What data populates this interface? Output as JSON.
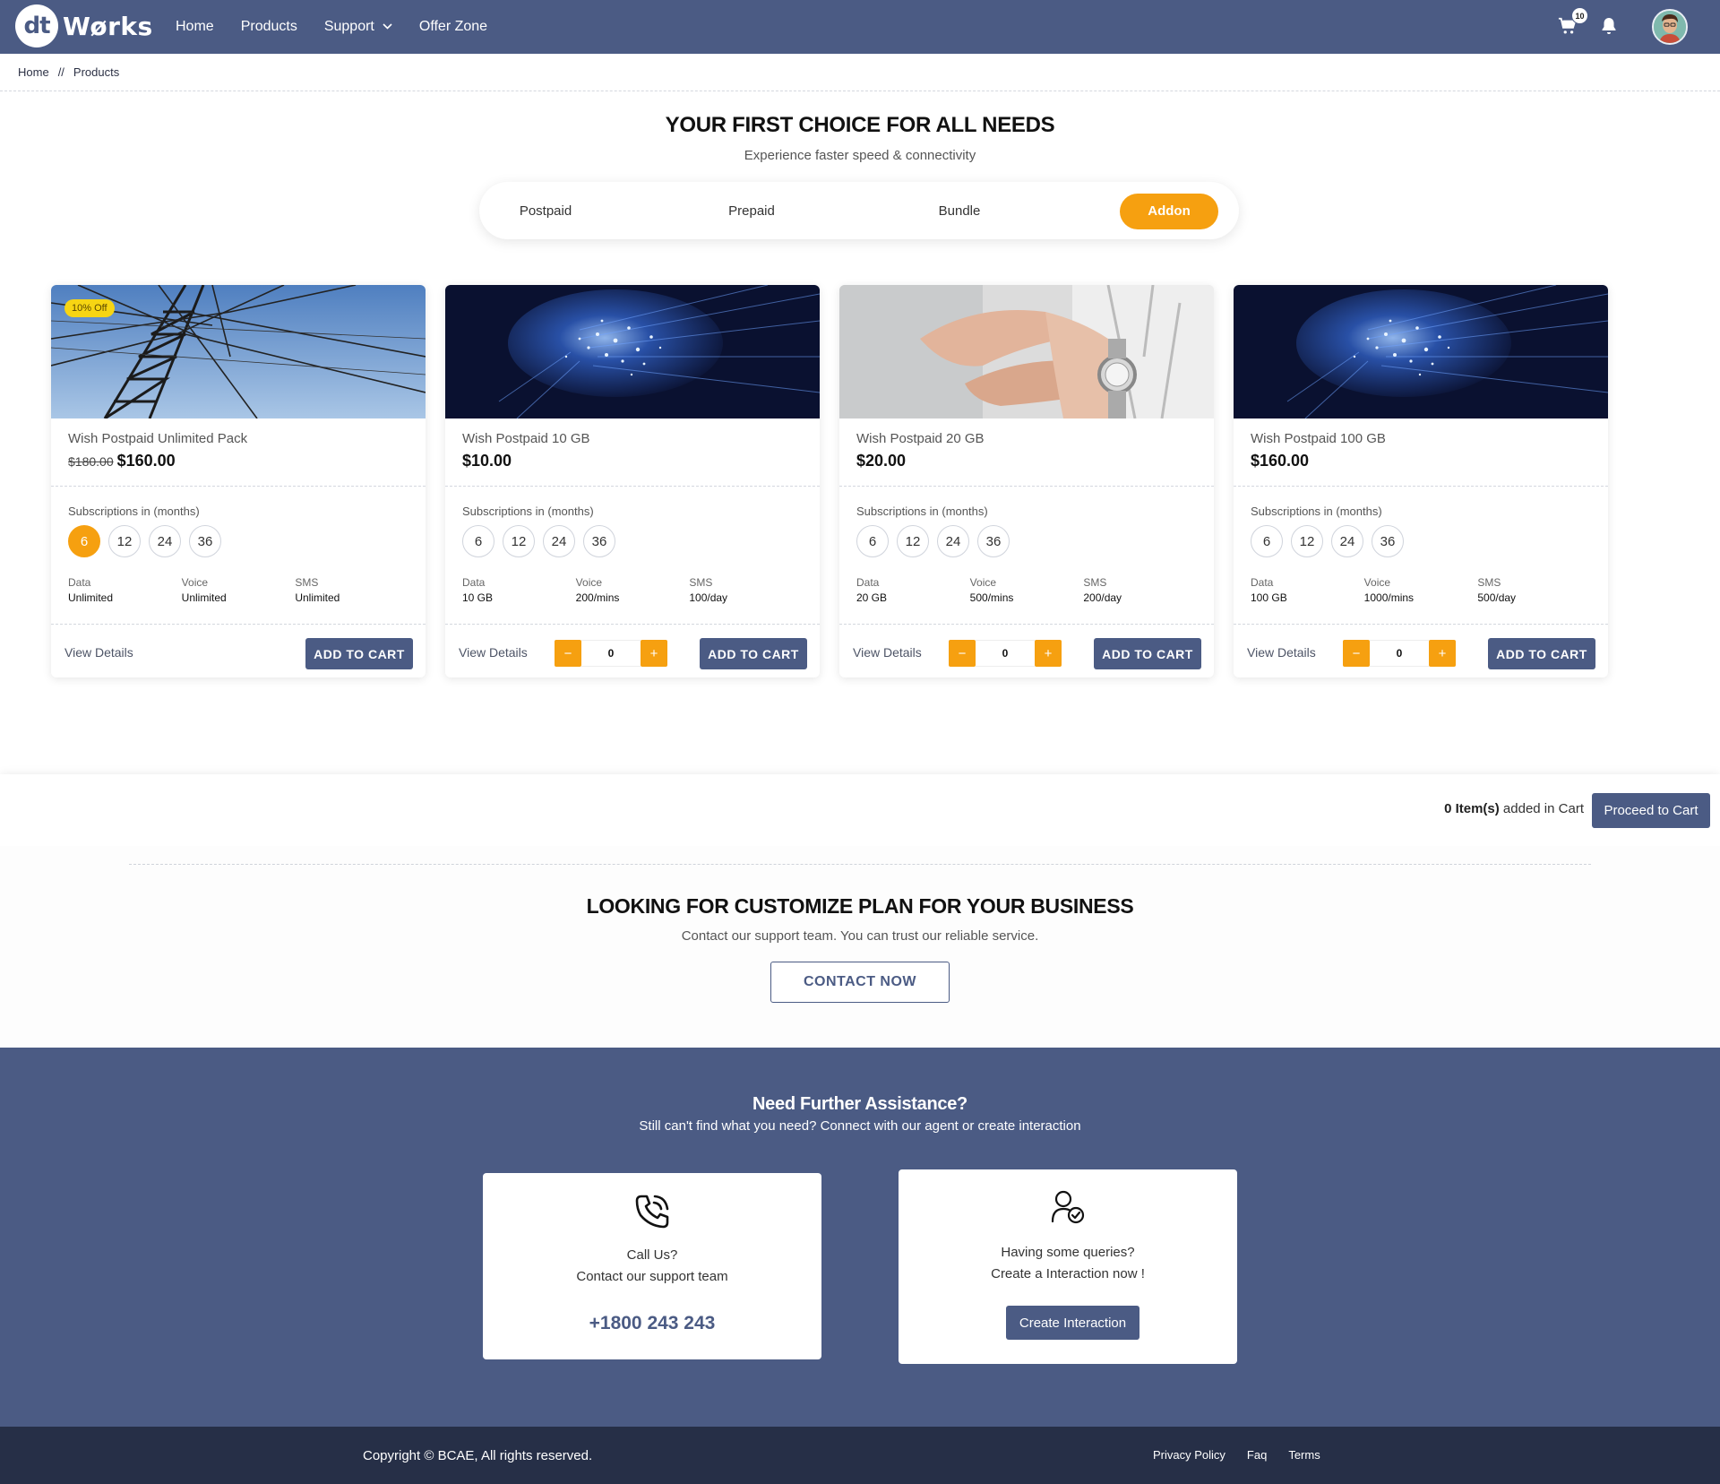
{
  "header": {
    "logo_mark": "dt",
    "logo_text": "Wørks",
    "nav": [
      "Home",
      "Products",
      "Support",
      "Offer Zone"
    ],
    "cart_count": "10"
  },
  "breadcrumb": {
    "home": "Home",
    "sep": "//",
    "current": "Products"
  },
  "hero": {
    "title": "YOUR FIRST CHOICE FOR ALL NEEDS",
    "subtitle": "Experience faster speed & connectivity",
    "tabs": [
      "Postpaid",
      "Prepaid",
      "Bundle",
      "Addon"
    ],
    "active_tab": "Addon"
  },
  "products": [
    {
      "badge": "10% Off",
      "name": "Wish Postpaid Unlimited Pack",
      "old_price": "$180.00",
      "price": "$160.00",
      "subs_label": "Subscriptions in (months)",
      "subs": [
        "6",
        "12",
        "24",
        "36"
      ],
      "selected_sub": "6",
      "specs": [
        {
          "k": "Data",
          "v": "Unlimited"
        },
        {
          "k": "Voice",
          "v": "Unlimited"
        },
        {
          "k": "SMS",
          "v": "Unlimited"
        }
      ],
      "view": "View Details",
      "cta": "ADD TO CART"
    },
    {
      "name": "Wish Postpaid 10 GB",
      "price": "$10.00",
      "subs_label": "Subscriptions in (months)",
      "subs": [
        "6",
        "12",
        "24",
        "36"
      ],
      "specs": [
        {
          "k": "Data",
          "v": "10 GB"
        },
        {
          "k": "Voice",
          "v": "200/mins"
        },
        {
          "k": "SMS",
          "v": "100/day"
        }
      ],
      "qty": "0",
      "minus": "−",
      "plus": "+",
      "view": "View Details",
      "cta": "ADD TO CART"
    },
    {
      "name": "Wish Postpaid 20 GB",
      "price": "$20.00",
      "subs_label": "Subscriptions in (months)",
      "subs": [
        "6",
        "12",
        "24",
        "36"
      ],
      "specs": [
        {
          "k": "Data",
          "v": "20 GB"
        },
        {
          "k": "Voice",
          "v": "500/mins"
        },
        {
          "k": "SMS",
          "v": "200/day"
        }
      ],
      "qty": "0",
      "minus": "−",
      "plus": "+",
      "view": "View Details",
      "cta": "ADD TO CART"
    },
    {
      "name": "Wish Postpaid 100 GB",
      "price": "$160.00",
      "subs_label": "Subscriptions in (months)",
      "subs": [
        "6",
        "12",
        "24",
        "36"
      ],
      "specs": [
        {
          "k": "Data",
          "v": "100 GB"
        },
        {
          "k": "Voice",
          "v": "1000/mins"
        },
        {
          "k": "SMS",
          "v": "500/day"
        }
      ],
      "qty": "0",
      "minus": "−",
      "plus": "+",
      "view": "View Details",
      "cta": "ADD TO CART"
    }
  ],
  "cart_strip": {
    "count_bold": "0 Item(s)",
    "count_rest": " added in Cart",
    "proceed": "Proceed to Cart"
  },
  "customize": {
    "title": "LOOKING FOR CUSTOMIZE PLAN FOR YOUR BUSINESS",
    "subtitle": "Contact our support team. You can trust our reliable service.",
    "button": "CONTACT NOW"
  },
  "assist": {
    "title": "Need Further Assistance?",
    "subtitle": "Still can't find what you need? Connect with our agent or create interaction",
    "call": {
      "icon": "phone-call-icon",
      "line1": "Call Us?",
      "line2": "Contact our support team",
      "phone": "+1800 243 243"
    },
    "interaction": {
      "icon": "user-check-icon",
      "line1": "Having some queries?",
      "line2": "Create a Interaction now !",
      "button": "Create Interaction"
    }
  },
  "footer": {
    "copyright": "Copyright © BCAE, All rights reserved.",
    "links": [
      "Privacy Policy",
      "Faq",
      "Terms"
    ]
  },
  "colors": {
    "primary": "#4b5b84",
    "accent": "#f6a010",
    "footer": "#262f47",
    "badge": "#f7d513"
  }
}
